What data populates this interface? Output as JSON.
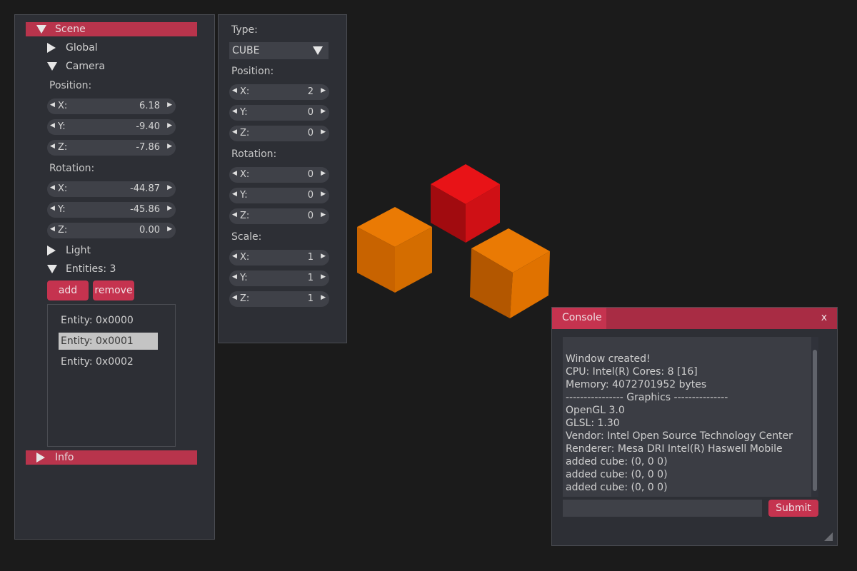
{
  "scene_panel": {
    "header": "Scene",
    "global": "Global",
    "camera": {
      "label": "Camera",
      "position_label": "Position:",
      "position": [
        {
          "k": "X:",
          "v": "6.18"
        },
        {
          "k": "Y:",
          "v": "-9.40"
        },
        {
          "k": "Z:",
          "v": "-7.86"
        }
      ],
      "rotation_label": "Rotation:",
      "rotation": [
        {
          "k": "X:",
          "v": "-44.87"
        },
        {
          "k": "Y:",
          "v": "-45.86"
        },
        {
          "k": "Z:",
          "v": "0.00"
        }
      ]
    },
    "light": "Light",
    "entities": {
      "label": "Entities: 3",
      "add": "add",
      "remove": "remove",
      "items": [
        "Entity: 0x0000",
        "Entity: 0x0001",
        "Entity: 0x0002"
      ],
      "selected_index": 1
    },
    "info": "Info"
  },
  "entity_panel": {
    "type_label": "Type:",
    "type_value": "CUBE",
    "position_label": "Position:",
    "position": [
      {
        "k": "X:",
        "v": "2"
      },
      {
        "k": "Y:",
        "v": "0"
      },
      {
        "k": "Z:",
        "v": "0"
      }
    ],
    "rotation_label": "Rotation:",
    "rotation": [
      {
        "k": "X:",
        "v": "0"
      },
      {
        "k": "Y:",
        "v": "0"
      },
      {
        "k": "Z:",
        "v": "0"
      }
    ],
    "scale_label": "Scale:",
    "scale": [
      {
        "k": "X:",
        "v": "1"
      },
      {
        "k": "Y:",
        "v": "1"
      },
      {
        "k": "Z:",
        "v": "1"
      }
    ]
  },
  "console": {
    "title": "Console",
    "close": "x",
    "lines": [
      "Window created!",
      "CPU: Intel(R) Cores: 8 [16]",
      "Memory: 4072701952 bytes",
      "---------------- Graphics ---------------",
      "OpenGL  3.0",
      "GLSL: 1.30",
      "Vendor: Intel Open Source Technology Center",
      "Renderer: Mesa DRI Intel(R) Haswell Mobile",
      "added cube: (0, 0 0)",
      "added cube: (0, 0 0)",
      "added cube: (0, 0 0)"
    ],
    "input_value": "",
    "submit": "Submit"
  },
  "colors": {
    "accent": "#c5334f",
    "panel_bg": "#2d2f35",
    "viewport_bg": "#1b1b1b",
    "cube_red": "#e00f16",
    "cube_orange": "#e87400"
  },
  "icons": {
    "expanded": "triangle-down-icon",
    "collapsed": "triangle-right-icon",
    "decrement": "arrow-left-icon",
    "increment": "arrow-right-icon",
    "dropdown": "chevron-down-icon",
    "resize": "resize-grip-icon"
  }
}
